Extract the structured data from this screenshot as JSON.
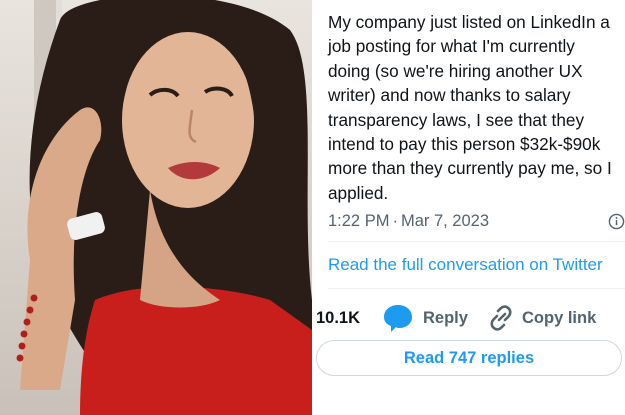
{
  "tweet": {
    "text": "My company just listed on LinkedIn a\njob posting for what I'm currently\ndoing (so we're hiring another UX\nwriter) and now thanks to salary\ntransparency laws, I see that they\nintend to pay this person $32k-$90k\nmore than they currently pay me, so I\napplied.",
    "time": "1:22 PM",
    "separator": "·",
    "date": "Mar 7, 2023",
    "read_full_label": "Read the full conversation on Twitter",
    "likes_count": "10.1K",
    "reply_label": "Reply",
    "copy_link_label": "Copy link",
    "read_replies_label": "Read 747 replies"
  },
  "icons": {
    "info": "info-circle-icon",
    "reply": "speech-bubble-icon",
    "copy": "link-icon"
  },
  "colors": {
    "accent": "#1d9bf0",
    "text": "#0f1419",
    "muted": "#536471",
    "border": "#cfd9de"
  }
}
